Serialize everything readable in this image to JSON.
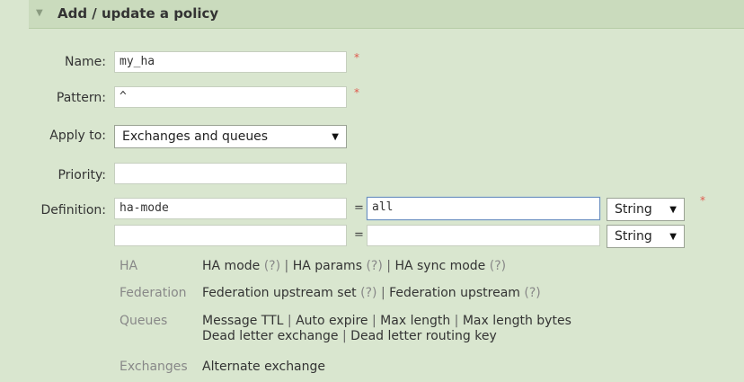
{
  "panel": {
    "title": "Add / update a policy"
  },
  "form": {
    "name": {
      "label": "Name:",
      "value": "my_ha",
      "required": "*"
    },
    "pattern": {
      "label": "Pattern:",
      "value": "^",
      "required": "*"
    },
    "apply_to": {
      "label": "Apply to:",
      "value": "Exchanges and queues"
    },
    "priority": {
      "label": "Priority:",
      "value": ""
    },
    "definition": {
      "label": "Definition:",
      "required": "*",
      "rows": [
        {
          "key": "ha-mode",
          "eq": "=",
          "value": "all",
          "type": "String"
        },
        {
          "key": "",
          "eq": "=",
          "value": "",
          "type": "String"
        }
      ]
    }
  },
  "help": {
    "ha": {
      "category": "HA",
      "links": [
        "HA mode",
        "HA params",
        "HA sync mode"
      ],
      "q": "(?)"
    },
    "federation": {
      "category": "Federation",
      "links": [
        "Federation upstream set",
        "Federation upstream"
      ],
      "q": "(?)"
    },
    "queues": {
      "category": "Queues",
      "line1": [
        "Message TTL",
        "Auto expire",
        "Max length",
        "Max length bytes"
      ],
      "line2": [
        "Dead letter exchange",
        "Dead letter routing key"
      ]
    },
    "exchanges": {
      "category": "Exchanges",
      "links": [
        "Alternate exchange"
      ]
    },
    "sep": "|"
  },
  "colors": {
    "background": "#d9e6cf",
    "header": "#cadbbd",
    "required": "#e05a4d"
  }
}
